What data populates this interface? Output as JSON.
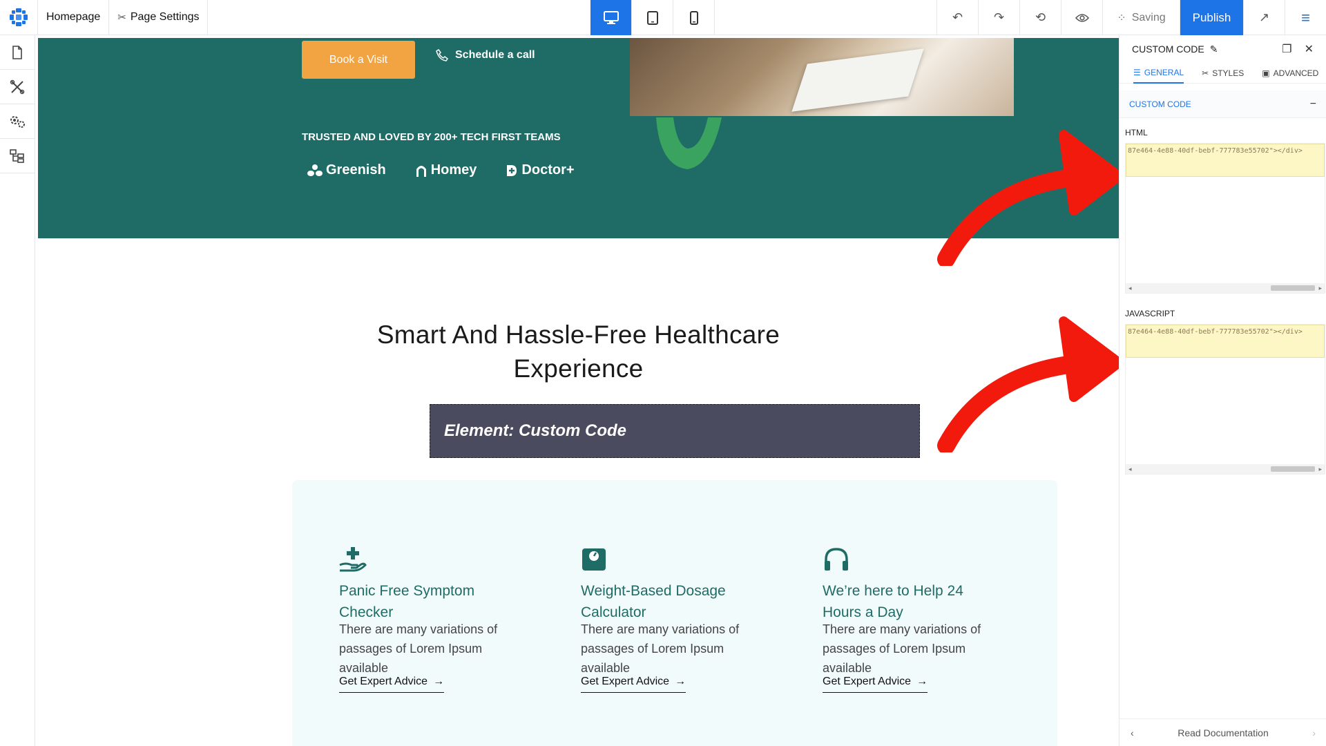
{
  "topbar": {
    "page_name": "Homepage",
    "page_settings": "Page Settings",
    "saving": "Saving",
    "publish": "Publish"
  },
  "hero": {
    "book_button": "Book a Visit",
    "schedule_call": "Schedule a call",
    "trusted": "TRUSTED AND LOVED BY 200+ TECH FIRST TEAMS",
    "brands": [
      "Greenish",
      "Homey",
      "Doctor+"
    ]
  },
  "section": {
    "headline_line1": "Smart And Hassle-Free Healthcare",
    "headline_line2": "Experience",
    "custom_element": "Element: Custom Code"
  },
  "features": [
    {
      "icon": "hand-plus-icon",
      "title_line1": "Panic Free Symptom",
      "title_line2": "Checker",
      "desc": "There are many variations of passages of Lorem Ipsum available",
      "link": "Get Expert Advice"
    },
    {
      "icon": "scale-icon",
      "title_line1": "Weight-Based Dosage",
      "title_line2": "Calculator",
      "desc": "There are many variations of passages of Lorem Ipsum available",
      "link": "Get Expert Advice"
    },
    {
      "icon": "headphones-icon",
      "title_line1": "We’re here to Help 24",
      "title_line2": "Hours a Day",
      "desc": "There are many variations of passages of Lorem Ipsum available",
      "link": "Get Expert Advice"
    }
  ],
  "panel": {
    "title": "CUSTOM CODE",
    "tabs": [
      "GENERAL",
      "STYLES",
      "ADVANCED"
    ],
    "section": "CUSTOM CODE",
    "html_label": "HTML",
    "html_code": "87e464-4e88-40df-bebf-777783e55702\"></div>",
    "js_label": "JAVASCRIPT",
    "js_code": "87e464-4e88-40df-bebf-777783e55702\"></div>",
    "footer": "Read Documentation"
  },
  "colors": {
    "accent": "#1d74e6",
    "hero_bg": "#1f6b66",
    "book_button": "#f2a443",
    "annotation_arrow": "#f21a0c"
  }
}
